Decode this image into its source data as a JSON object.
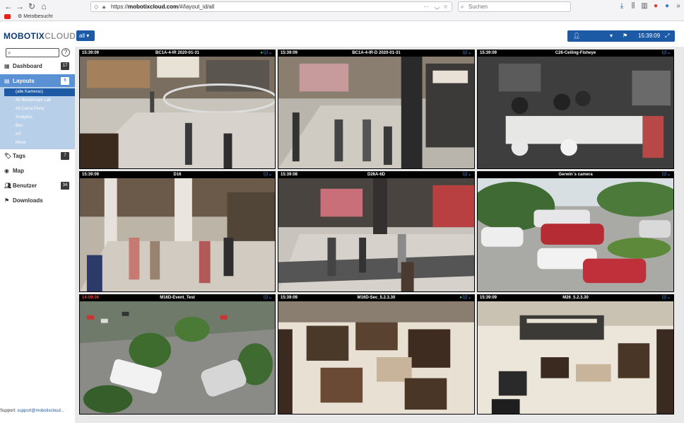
{
  "browser": {
    "url_prefix": "https://",
    "url_domain": "mobotixcloud.com",
    "url_path": "/#/layout_id/all",
    "search_placeholder": "Suchen",
    "bookmark_label": "Meistbesucht"
  },
  "app": {
    "logo_part1": "MOBOTIX",
    "logo_part2": "CLOUD",
    "layout_selector": "all",
    "time": "15:39:09"
  },
  "sidebar": {
    "nav": [
      {
        "label": "Dashboard",
        "count": "17"
      },
      {
        "label": "Layouts",
        "count": "6"
      },
      {
        "label": "Tags",
        "count": "7"
      },
      {
        "label": "Map"
      },
      {
        "label": "Benutzer",
        "count": "34"
      },
      {
        "label": "Downloads"
      }
    ],
    "layouts": [
      "(alle Kameras)",
      "All Benchmark Lab",
      "All Cama Perry",
      "Analytics",
      "Box",
      "IoT",
      "Move"
    ],
    "support_label": "Support:",
    "support_email": "support@mobotixcloud..."
  },
  "cameras": [
    {
      "time": "15:39:09",
      "name": "BC1A-4-IR 2020-01-31"
    },
    {
      "time": "15:39:09",
      "name": "BC1A-4-IR-D 2020-01-31"
    },
    {
      "time": "15:39:09",
      "name": "C26-Ceiling-Fisheye"
    },
    {
      "time": "15:39:09",
      "name": "D16"
    },
    {
      "time": "15:39:08",
      "name": "D26A-6D"
    },
    {
      "time": "",
      "name": "Gerwin´s camera"
    },
    {
      "time": "14:09:36",
      "name": "M16D-Event_Test"
    },
    {
      "time": "15:39:09",
      "name": "M16D-Sec_5.2.3.30"
    },
    {
      "time": "15:39:09",
      "name": "M26_5.2.3.30"
    }
  ],
  "colors": {
    "brand_blue": "#1c5aa6",
    "sidebar_active": "#5a90d4",
    "layout_list_bg": "#b7cfe8",
    "stale_time": "#ff3b3b"
  }
}
